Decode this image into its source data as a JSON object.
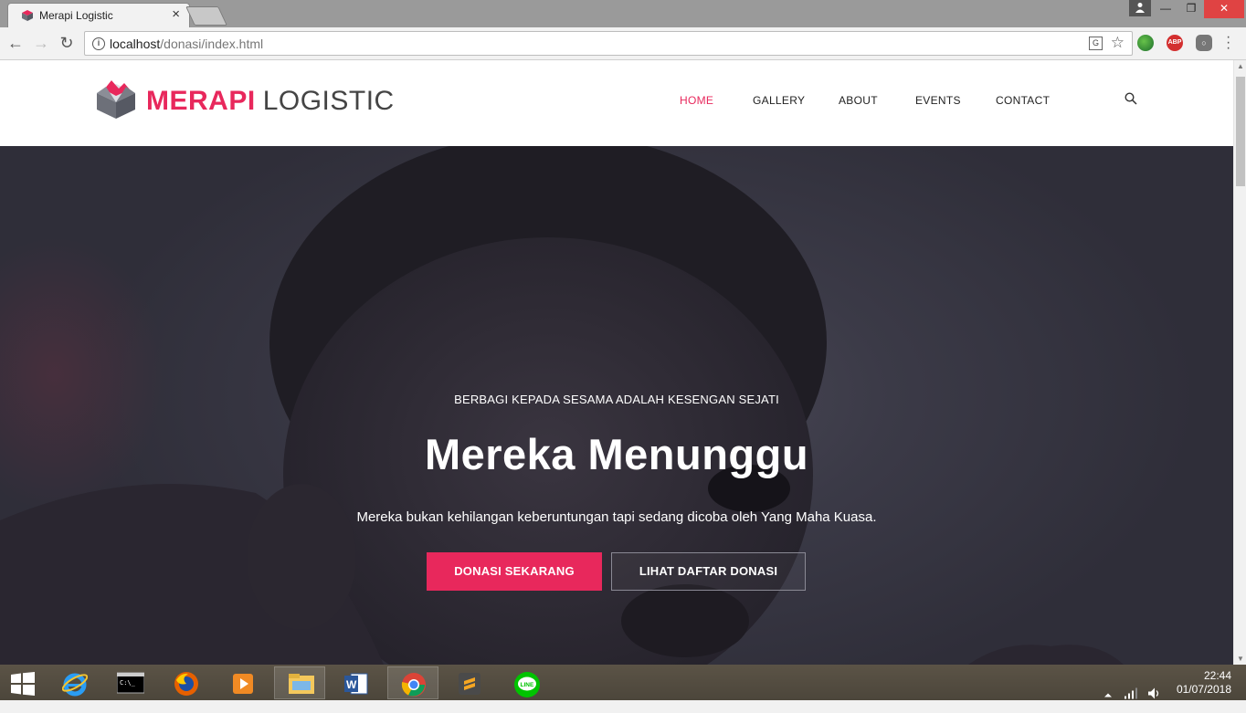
{
  "browser": {
    "tab_title": "Merapi Logistic",
    "tab_close": "×",
    "url_host": "localhost",
    "url_path": "/donasi/index.html",
    "ext_abp": "ABP"
  },
  "site": {
    "logo_strong": "MERAPI",
    "logo_light": "LOGISTIC",
    "accent_color": "#e8285c",
    "nav": [
      {
        "label": "HOME",
        "active": true
      },
      {
        "label": "GALLERY",
        "active": false
      },
      {
        "label": "ABOUT",
        "active": false
      },
      {
        "label": "EVENTS",
        "active": false
      },
      {
        "label": "CONTACT",
        "active": false
      }
    ]
  },
  "hero": {
    "tagline": "BERBAGI KEPADA SESAMA ADALAH KESENGAN SEJATI",
    "title": "Mereka Menunggu",
    "subtitle": "Mereka bukan kehilangan keberuntungan tapi sedang dicoba oleh Yang Maha Kuasa.",
    "primary_button": "DONASI SEKARANG",
    "secondary_button": "LIHAT DAFTAR DONASI"
  },
  "taskbar": {
    "apps": [
      "windows-start",
      "internet-explorer",
      "command-prompt",
      "firefox",
      "media-player",
      "file-explorer",
      "word",
      "chrome",
      "sublime-text",
      "line"
    ],
    "time": "22:44",
    "date": "01/07/2018"
  }
}
